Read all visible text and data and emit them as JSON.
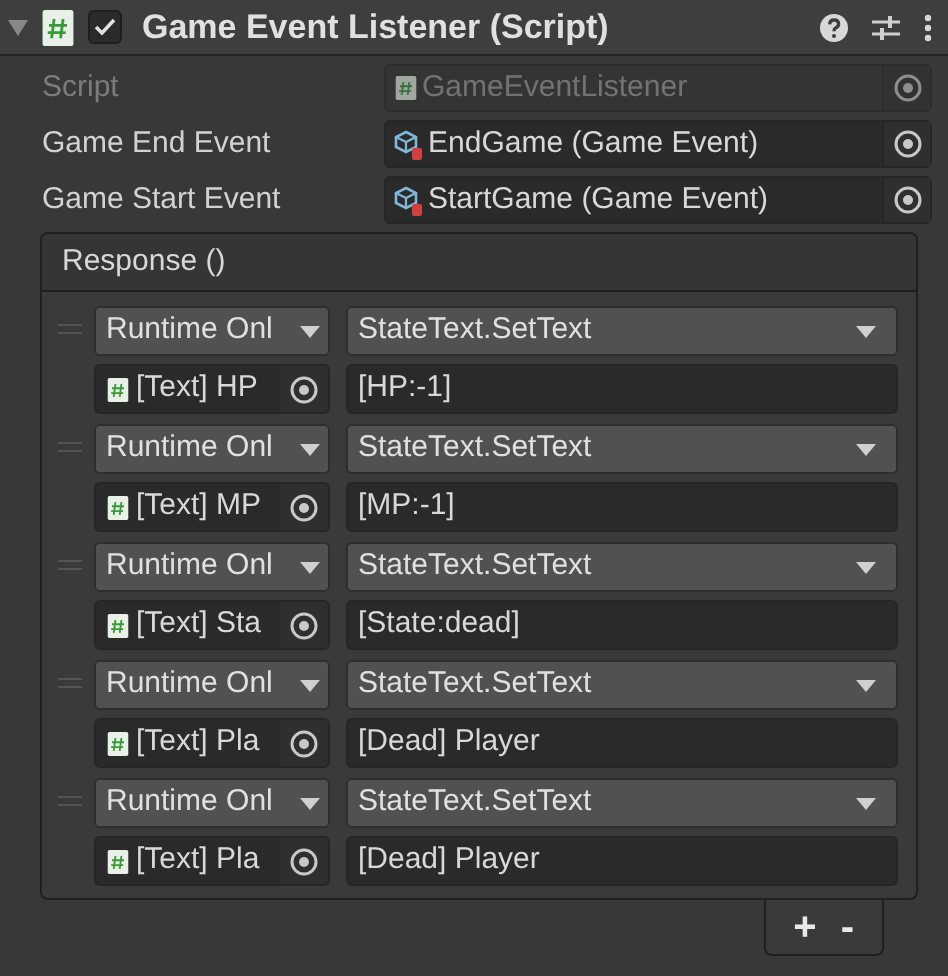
{
  "component": {
    "title": "Game Event Listener (Script)",
    "expanded": true,
    "enabled": true
  },
  "fields": [
    {
      "label": "Script",
      "value": "GameEventListener",
      "kind": "script",
      "disabled": true
    },
    {
      "label": "Game End Event",
      "value": "EndGame (Game Event)",
      "kind": "asset",
      "disabled": false
    },
    {
      "label": "Game Start Event",
      "value": "StartGame (Game Event)",
      "kind": "asset",
      "disabled": false
    }
  ],
  "response": {
    "title": "Response ()",
    "entries": [
      {
        "mode": "Runtime Onl",
        "function": "StateText.SetText",
        "target": "[Text] HP",
        "argument": "[HP:-1]"
      },
      {
        "mode": "Runtime Onl",
        "function": "StateText.SetText",
        "target": "[Text] MP",
        "argument": "[MP:-1]"
      },
      {
        "mode": "Runtime Onl",
        "function": "StateText.SetText",
        "target": "[Text] Sta",
        "argument": "[State:dead]"
      },
      {
        "mode": "Runtime Onl",
        "function": "StateText.SetText",
        "target": "[Text] Pla",
        "argument": "[Dead] Player"
      },
      {
        "mode": "Runtime Onl",
        "function": "StateText.SetText",
        "target": "[Text] Pla",
        "argument": "[Dead] Player"
      }
    ],
    "add_label": "+",
    "remove_label": "-"
  }
}
